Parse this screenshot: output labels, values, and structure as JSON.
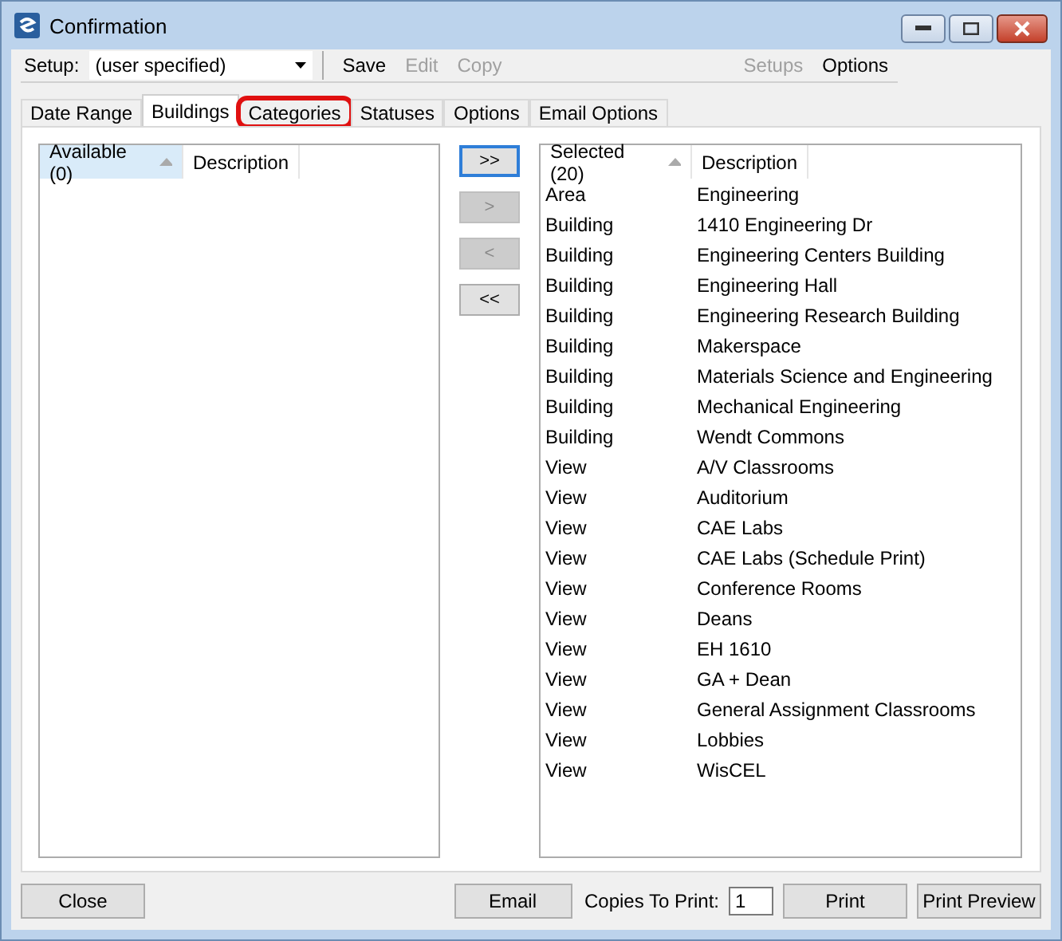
{
  "window": {
    "title": "Confirmation"
  },
  "toolbar": {
    "setup_label": "Setup:",
    "setup_value": "(user specified)",
    "actions": [
      {
        "label": "Save",
        "disabled": false
      },
      {
        "label": "Edit",
        "disabled": true
      },
      {
        "label": "Copy",
        "disabled": true
      }
    ],
    "right_actions": [
      {
        "label": "Setups",
        "disabled": true
      },
      {
        "label": "Options",
        "disabled": false
      }
    ]
  },
  "tabs": [
    {
      "label": "Date Range",
      "selected": false,
      "highlighted": false
    },
    {
      "label": "Buildings",
      "selected": true,
      "highlighted": false
    },
    {
      "label": "Categories",
      "selected": false,
      "highlighted": true
    },
    {
      "label": "Statuses",
      "selected": false,
      "highlighted": false
    },
    {
      "label": "Options",
      "selected": false,
      "highlighted": false
    },
    {
      "label": "Email Options",
      "selected": false,
      "highlighted": false
    }
  ],
  "available": {
    "columns": [
      "Available (0)",
      "Description"
    ]
  },
  "move_buttons": [
    {
      "label": ">>",
      "disabled": false,
      "focused": true
    },
    {
      "label": ">",
      "disabled": true,
      "focused": false
    },
    {
      "label": "<",
      "disabled": true,
      "focused": false
    },
    {
      "label": "<<",
      "disabled": false,
      "focused": false
    }
  ],
  "selected": {
    "columns": [
      "Selected (20)",
      "Description"
    ],
    "rows": [
      [
        "Area",
        "Engineering"
      ],
      [
        "Building",
        "1410 Engineering Dr"
      ],
      [
        "Building",
        "Engineering Centers Building"
      ],
      [
        "Building",
        "Engineering Hall"
      ],
      [
        "Building",
        "Engineering Research Building"
      ],
      [
        "Building",
        "Makerspace"
      ],
      [
        "Building",
        "Materials Science and Engineering"
      ],
      [
        "Building",
        "Mechanical Engineering"
      ],
      [
        "Building",
        "Wendt Commons"
      ],
      [
        "View",
        "A/V Classrooms"
      ],
      [
        "View",
        "Auditorium"
      ],
      [
        "View",
        "CAE Labs"
      ],
      [
        "View",
        "CAE Labs (Schedule Print)"
      ],
      [
        "View",
        "Conference Rooms"
      ],
      [
        "View",
        "Deans"
      ],
      [
        "View",
        "EH 1610"
      ],
      [
        "View",
        "GA + Dean"
      ],
      [
        "View",
        "General Assignment Classrooms"
      ],
      [
        "View",
        "Lobbies"
      ],
      [
        "View",
        "WisCEL"
      ]
    ]
  },
  "footer": {
    "close": "Close",
    "email": "Email",
    "copies_label": "Copies To Print:",
    "copies_value": "1",
    "print": "Print",
    "print_preview": "Print Preview"
  }
}
